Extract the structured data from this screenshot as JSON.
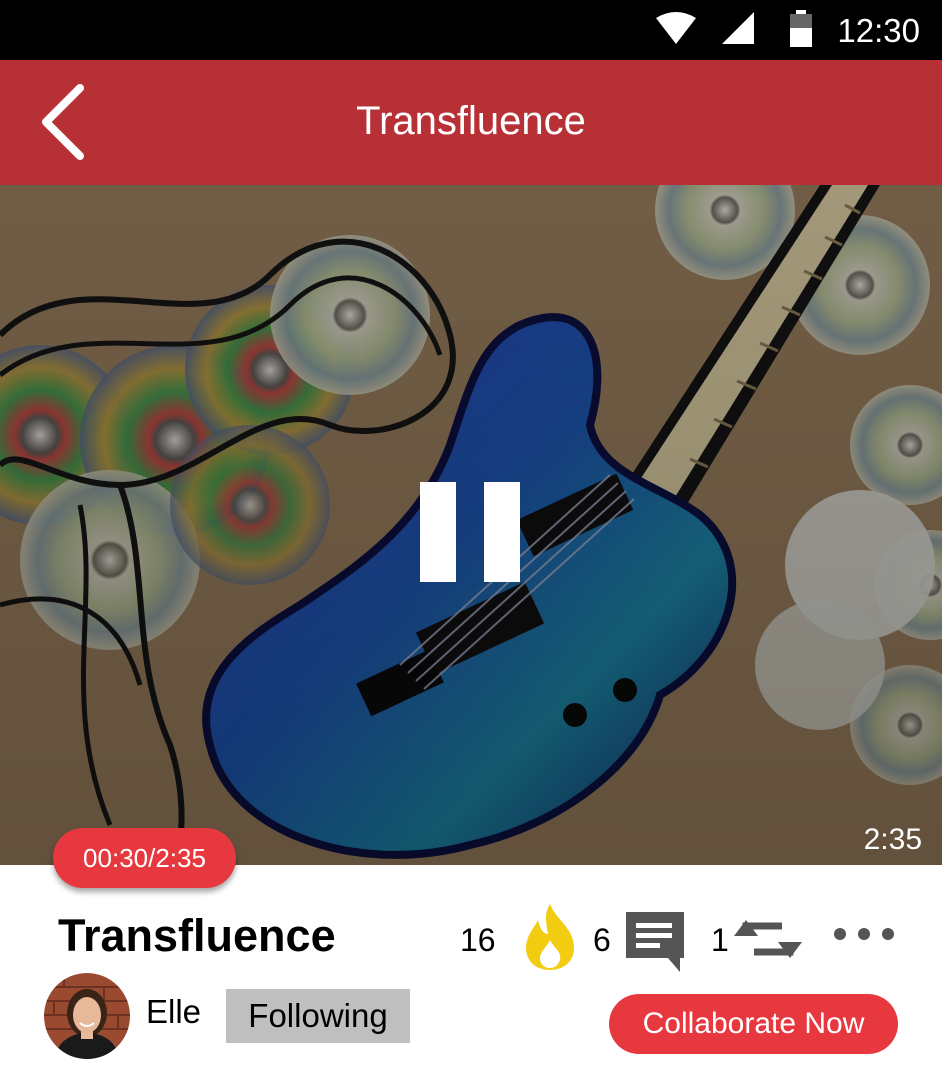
{
  "status_bar": {
    "time": "12:30",
    "icons": [
      "wifi-icon",
      "cellular-signal-icon",
      "battery-icon"
    ]
  },
  "app_bar": {
    "title": "Transfluence",
    "back_icon": "chevron-left-icon"
  },
  "player": {
    "artwork": "blue electric guitar lying on carpet among scattered CDs and cables",
    "state": "playing",
    "control_icon": "pause-icon",
    "duration": "2:35",
    "progress_text": "00:30/2:35",
    "progress_fraction": 0.19
  },
  "track": {
    "title": "Transfluence",
    "fire_count": "16",
    "comment_count": "6",
    "repost_count": "1",
    "icons": [
      "fire-icon",
      "comment-icon",
      "repost-icon",
      "more-icon"
    ]
  },
  "user": {
    "name": "Elle",
    "follow_label": "Following",
    "avatar_icon": "user-avatar"
  },
  "actions": {
    "collaborate_label": "Collaborate Now"
  },
  "colors": {
    "app_bar": "#b63036",
    "accent": "#e8383f",
    "fire": "#f2cc10",
    "icon_gray": "#555555",
    "follow_bg": "#bfbfbf"
  }
}
